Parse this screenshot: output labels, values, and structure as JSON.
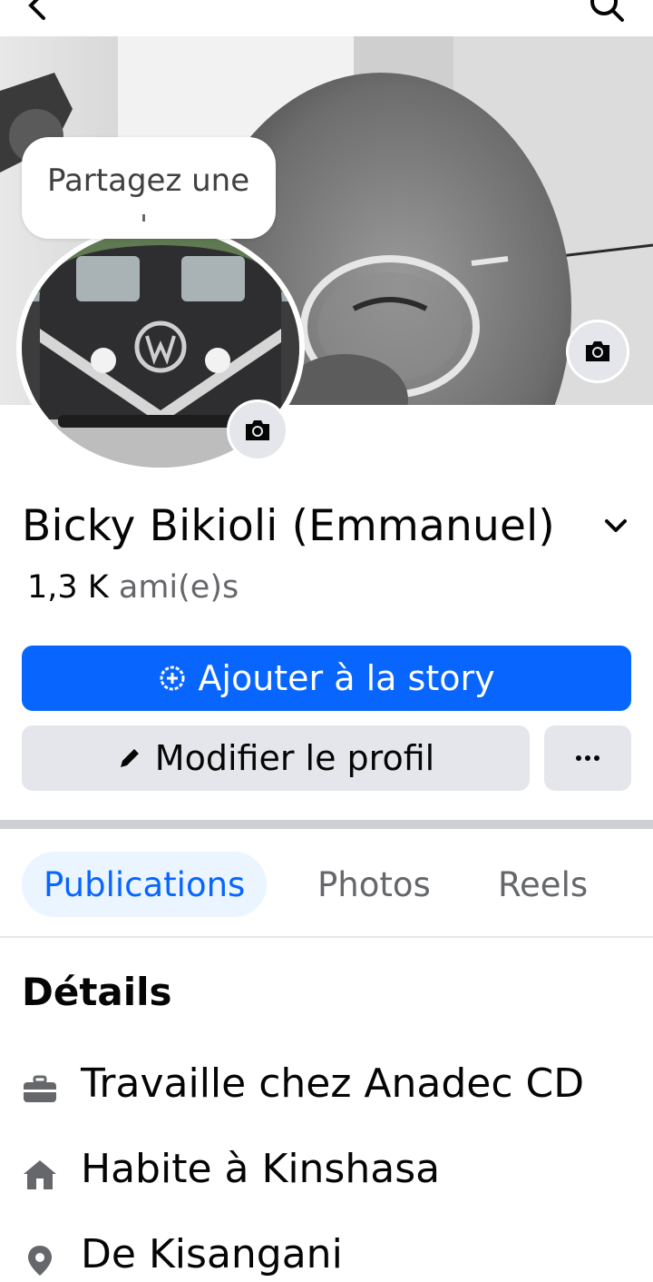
{
  "note": {
    "text": "Partagez une"
  },
  "profile": {
    "name": "Bicky Bikioli (Emmanuel)",
    "friends_count": "1,3 K",
    "friends_label": "ami(e)s"
  },
  "actions": {
    "add_story_label": "Ajouter à la story",
    "edit_profile_label": "Modifier le profil",
    "more_label": "···"
  },
  "tabs": [
    {
      "label": "Publications",
      "active": true
    },
    {
      "label": "Photos",
      "active": false
    },
    {
      "label": "Reels",
      "active": false
    }
  ],
  "details": {
    "title": "Détails",
    "items": [
      {
        "icon": "briefcase-icon",
        "text": "Travaille chez Anadec CD"
      },
      {
        "icon": "home-icon",
        "text": "Habite à Kinshasa"
      },
      {
        "icon": "location-pin-icon",
        "text": "De Kisangani"
      }
    ]
  },
  "colors": {
    "primary_blue": "#0866ff",
    "button_gray": "#e4e6eb",
    "secondary_text": "#65676b",
    "active_tab_bg": "#ebf5ff"
  }
}
